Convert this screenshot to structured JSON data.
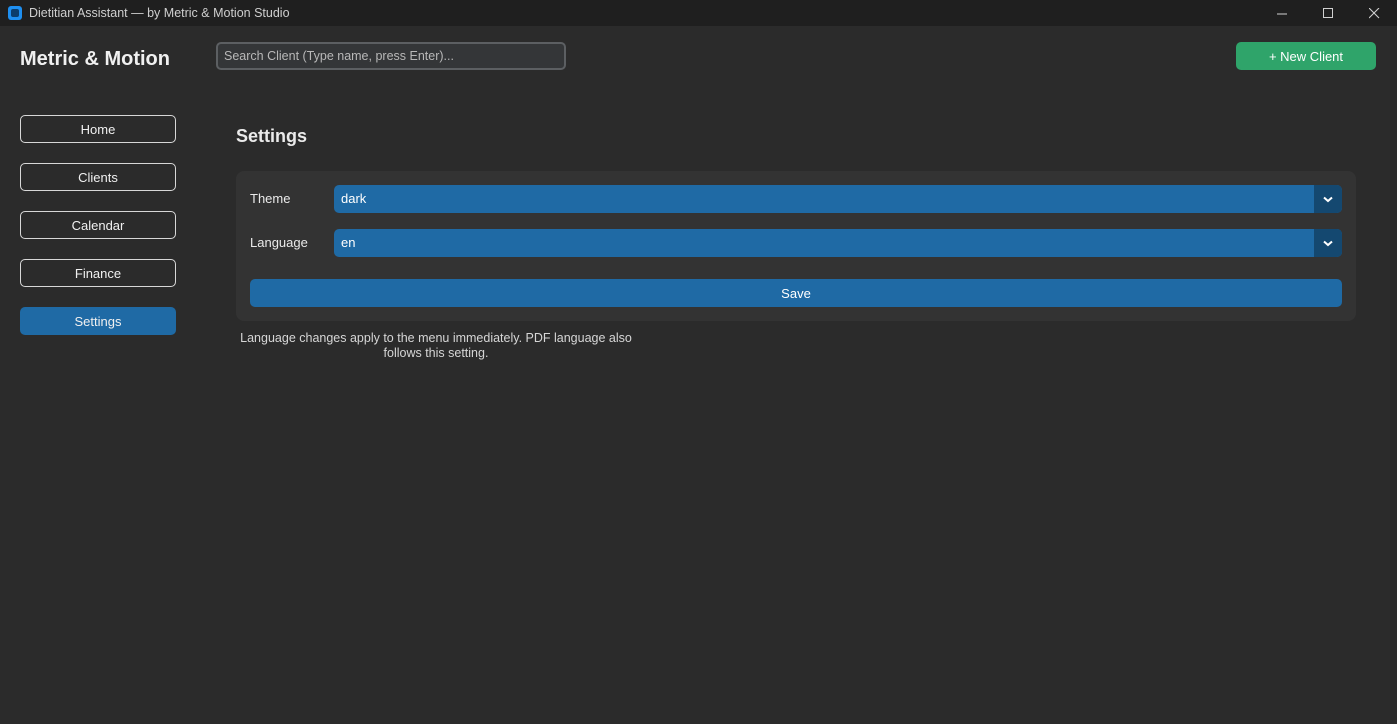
{
  "window": {
    "title": "Dietitian Assistant — by Metric & Motion Studio",
    "controls": {
      "minimize": "—",
      "maximize": "☐",
      "close": "✕"
    }
  },
  "header": {
    "brand": "Metric & Motion",
    "search": {
      "placeholder": "Search Client (Type name, press Enter)...",
      "value": ""
    },
    "new_client_label": "+ New Client"
  },
  "sidebar": {
    "items": [
      {
        "label": "Home",
        "active": false
      },
      {
        "label": "Clients",
        "active": false
      },
      {
        "label": "Calendar",
        "active": false
      },
      {
        "label": "Finance",
        "active": false
      },
      {
        "label": "Settings",
        "active": true
      }
    ]
  },
  "settings": {
    "title": "Settings",
    "theme": {
      "label": "Theme",
      "value": "dark"
    },
    "language": {
      "label": "Language",
      "value": "en"
    },
    "save_label": "Save",
    "note": "Language changes apply to the menu immediately. PDF language also follows this setting."
  },
  "colors": {
    "background": "#2b2b2b",
    "titlebar": "#1f1f1f",
    "accent_blue": "#1f6aa5",
    "accent_green": "#2fa46a",
    "card": "#333333"
  },
  "icons": {
    "app": "app-icon",
    "dropdown": "chevron-down-icon"
  }
}
